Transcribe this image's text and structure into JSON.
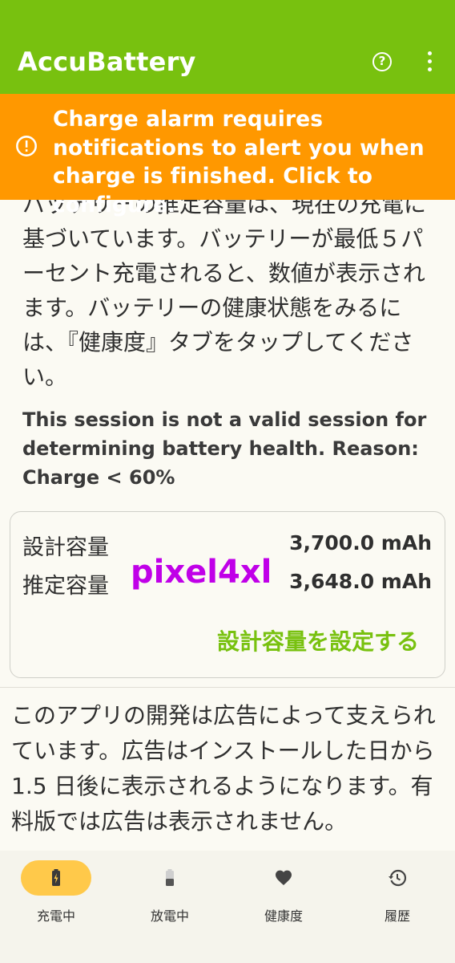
{
  "appbar": {
    "title": "AccuBattery",
    "help_icon": "help-circle-icon",
    "more_icon": "more-vertical-icon"
  },
  "alert": {
    "icon": "alert-circle-icon",
    "text": "Charge alarm requires notifications to alert you when charge is finished. Click to configure.",
    "color": "#ff9800"
  },
  "intro": {
    "text": "バッテリーの推定容量は、現在の充電に基づいています。バッテリーが最低５パーセント充電されると、数値が表示されます。バッテリーの健康状態をみるには、『健康度』タブをタップしてください。"
  },
  "session_note": "This session is not a valid session for determining battery health. Reason: Charge < 60%",
  "capacity_card": {
    "design_label": "設計容量",
    "design_value": "3,700.0 mAh",
    "estimated_label": "推定容量",
    "estimated_value": "3,648.0 mAh",
    "watermark": "pixel4xl",
    "set_link": "設計容量を設定する"
  },
  "ad_notice": "このアプリの開発は広告によって支えられています。広告はインストールした日から1.5 日後に表示されるようになります。有料版では広告は表示されません。",
  "bottom_nav": {
    "items": [
      {
        "label": "充電中",
        "icon": "battery-charging-icon",
        "active": true
      },
      {
        "label": "放電中",
        "icon": "battery-discharging-icon",
        "active": false
      },
      {
        "label": "健康度",
        "icon": "heart-icon",
        "active": false
      },
      {
        "label": "履歴",
        "icon": "history-icon",
        "active": false
      }
    ]
  },
  "colors": {
    "appbar": "#78c10f",
    "accent": "#78c10f",
    "active_tab": "#ffc94a",
    "watermark": "#c000e8"
  }
}
